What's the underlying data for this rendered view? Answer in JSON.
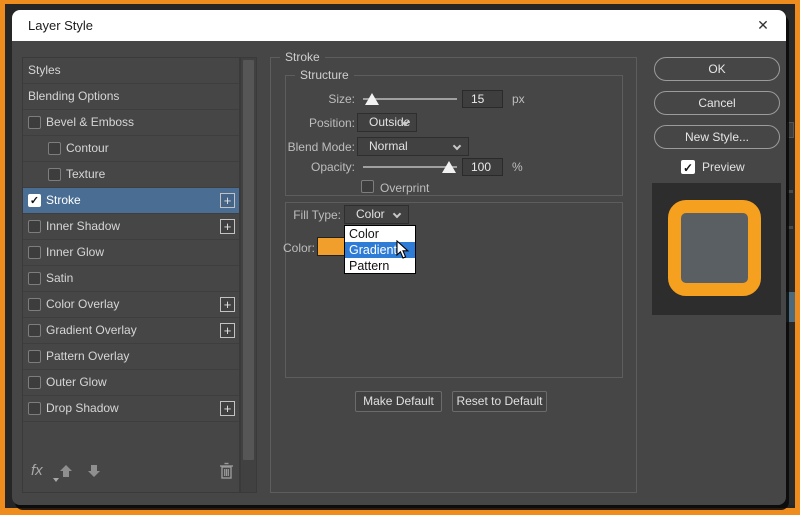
{
  "window": {
    "title": "Layer Style"
  },
  "icons": {
    "close": "✕",
    "check": "✓",
    "plus": "+",
    "fx": "fx"
  },
  "sidebar": {
    "items": [
      {
        "label": "Styles"
      },
      {
        "label": "Blending Options"
      },
      {
        "label": "Bevel & Emboss"
      },
      {
        "label": "Contour"
      },
      {
        "label": "Texture"
      },
      {
        "label": "Stroke"
      },
      {
        "label": "Inner Shadow"
      },
      {
        "label": "Inner Glow"
      },
      {
        "label": "Satin"
      },
      {
        "label": "Color Overlay"
      },
      {
        "label": "Gradient Overlay"
      },
      {
        "label": "Pattern Overlay"
      },
      {
        "label": "Outer Glow"
      },
      {
        "label": "Drop Shadow"
      }
    ],
    "selected_item": "Stroke"
  },
  "panel": {
    "group_title": "Stroke",
    "structure": {
      "title": "Structure",
      "size_label": "Size:",
      "size_value": "15",
      "size_unit": "px",
      "position_label": "Position:",
      "position_value": "Outside",
      "blend_mode_label": "Blend Mode:",
      "blend_mode_value": "Normal",
      "opacity_label": "Opacity:",
      "opacity_value": "100",
      "opacity_unit": "%",
      "overprint_label": "Overprint"
    },
    "fill": {
      "fill_type_label": "Fill Type:",
      "fill_type_value": "Color",
      "color_label": "Color:",
      "swatch_color": "#f09e2c",
      "dropdown_options": [
        "Color",
        "Gradient",
        "Pattern"
      ],
      "highlighted_option": "Gradient"
    },
    "buttons": {
      "make_default": "Make Default",
      "reset_default": "Reset to Default"
    }
  },
  "actions": {
    "ok": "OK",
    "cancel": "Cancel",
    "new_style": "New Style...",
    "preview_label": "Preview"
  },
  "colors": {
    "frame_orange": "#ee8c1e",
    "stroke_orange": "#f5a01e",
    "selection_blue": "#4a6d94",
    "dropdown_highlight_blue": "#2e7cd6",
    "dialog_gray": "#464646"
  }
}
